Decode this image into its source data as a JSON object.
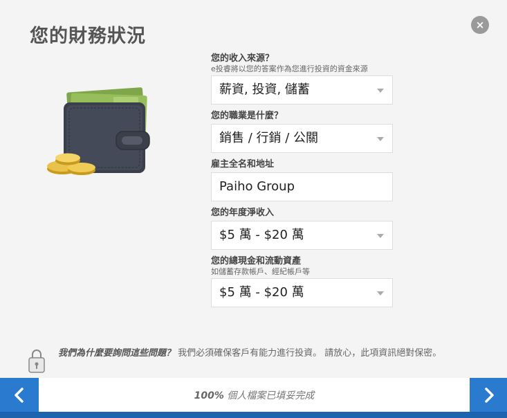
{
  "page": {
    "title": "您的財務狀況",
    "close_label": "×"
  },
  "form": {
    "income_source": {
      "label": "您的收入來源？",
      "sublabel": "e投睿將以您的答案作為您進行投資的資金來源",
      "value": "薪資, 投資, 儲蓄"
    },
    "occupation": {
      "label": "您的職業是什麼？",
      "value": "銷售 / 行銷 / 公關"
    },
    "employer": {
      "label": "雇主全名和地址",
      "value": "Paiho Group"
    },
    "annual_income": {
      "label": "您的年度淨收入",
      "value": "$5 萬 - $20 萬"
    },
    "liquid_assets": {
      "label": "您的總現金和流動資產",
      "sublabel": "如儲蓄存款帳戶、經紀帳戶等",
      "value": "$5 萬 - $20 萬"
    }
  },
  "note": {
    "question": "我們為什麼要詢問這些問題？",
    "answer": " 我們必須確保客戶有能力進行投資。 請放心，此項資訊絕對保密。"
  },
  "progress": {
    "percent_label": "100%",
    "text": " 個人檔案已填妥完成",
    "value": 1.0
  },
  "icons": [
    "close-icon",
    "wallet-icon",
    "coins-icon",
    "lock-icon",
    "chevron-left-icon",
    "chevron-right-icon",
    "dropdown-caret-icon"
  ],
  "colors": {
    "accent": "#2a7bcf",
    "background": "#f4f4f4"
  }
}
